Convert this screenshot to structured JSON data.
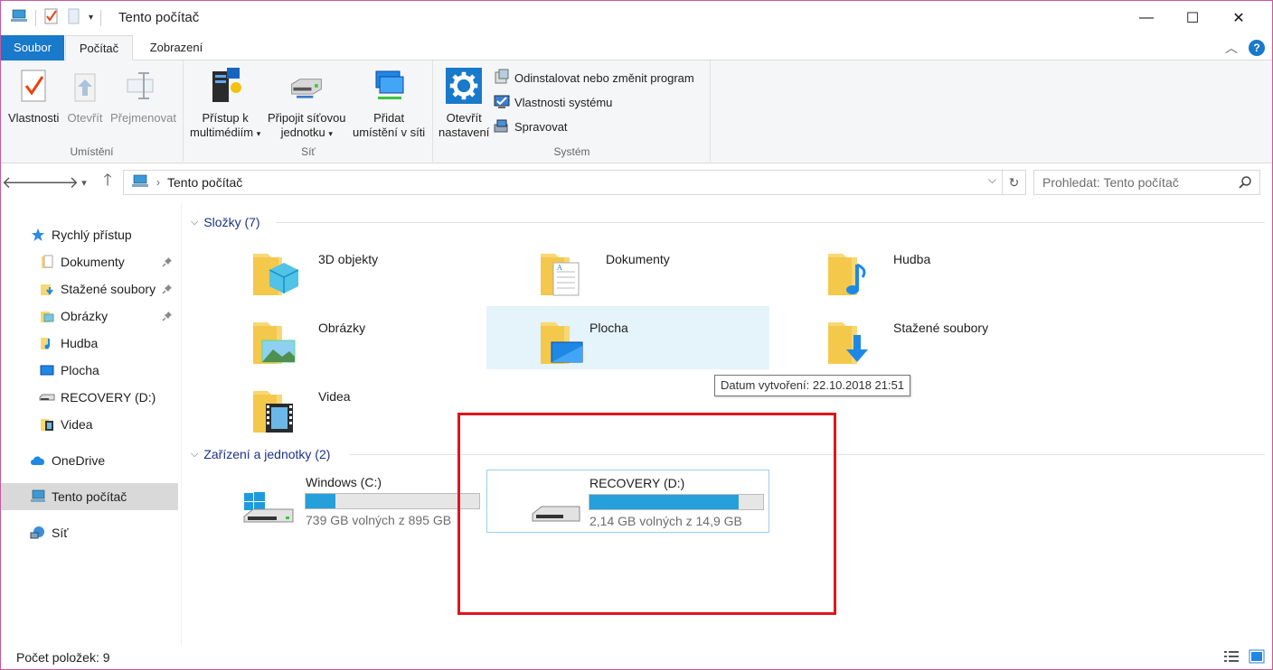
{
  "window": {
    "title": "Tento počítač",
    "minimize_symbol": "—",
    "maximize_symbol": "☐",
    "close_symbol": "✕"
  },
  "ribbon_tabs": [
    {
      "label": "Soubor"
    },
    {
      "label": "Počítač"
    },
    {
      "label": "Zobrazení"
    }
  ],
  "ribbon": {
    "groups": {
      "location": {
        "label": "Umístění",
        "buttons": [
          {
            "label": "Vlastnosti",
            "icon": "properties-check-icon"
          },
          {
            "label": "Otevřít",
            "icon": "open-arrow-icon"
          },
          {
            "label": "Přejmenovat",
            "icon": "rename-icon"
          }
        ]
      },
      "network": {
        "label": "Síť",
        "buttons": [
          {
            "line1": "Přístup k",
            "line2": "multimédiím",
            "icon": "media-server-icon"
          },
          {
            "line1": "Připojit síťovou",
            "line2": "jednotku",
            "icon": "network-drive-icon"
          },
          {
            "line1": "Přidat",
            "line2": "umístění v síti",
            "icon": "network-location-icon"
          }
        ]
      },
      "system": {
        "label": "Systém",
        "open_settings": {
          "line1": "Otevřít",
          "line2": "nastavení",
          "icon": "settings-gear-icon"
        },
        "small": [
          {
            "label": "Odinstalovat nebo změnit program",
            "icon": "uninstall-icon"
          },
          {
            "label": "Vlastnosti systému",
            "icon": "system-properties-icon"
          },
          {
            "label": "Spravovat",
            "icon": "manage-icon"
          }
        ]
      }
    }
  },
  "address": {
    "path": "Tento počítač",
    "search_placeholder": "Prohledat: Tento počítač"
  },
  "sidebar": {
    "items": [
      {
        "label": "Rychlý přístup",
        "icon": "star-icon"
      },
      {
        "label": "Dokumenty",
        "icon": "documents-icon",
        "pinned": true
      },
      {
        "label": "Stažené soubory",
        "icon": "downloads-icon",
        "pinned": true
      },
      {
        "label": "Obrázky",
        "icon": "pictures-icon",
        "pinned": true
      },
      {
        "label": "Hudba",
        "icon": "music-icon"
      },
      {
        "label": "Plocha",
        "icon": "desktop-icon"
      },
      {
        "label": "RECOVERY (D:)",
        "icon": "drive-icon"
      },
      {
        "label": "Videa",
        "icon": "videos-icon"
      },
      {
        "label": "OneDrive",
        "icon": "onedrive-cloud-icon"
      },
      {
        "label": "Tento počítač",
        "icon": "this-pc-icon",
        "selected": true
      },
      {
        "label": "Síť",
        "icon": "network-icon"
      }
    ]
  },
  "content": {
    "folders_header": "Složky (7)",
    "folders": [
      {
        "label": "3D objekty",
        "icon": "3d-objects-folder-icon"
      },
      {
        "label": "Dokumenty",
        "icon": "documents-folder-icon"
      },
      {
        "label": "Hudba",
        "icon": "music-folder-icon"
      },
      {
        "label": "Obrázky",
        "icon": "pictures-folder-icon"
      },
      {
        "label": "Plocha",
        "icon": "desktop-folder-icon"
      },
      {
        "label": "Stažené soubory",
        "icon": "downloads-folder-icon"
      },
      {
        "label": "Videa",
        "icon": "videos-folder-icon"
      }
    ],
    "drives_header": "Zařízení a jednotky (2)",
    "drives": [
      {
        "label": "Windows (C:)",
        "free_text": "739 GB volných z 895 GB",
        "used_fraction": 0.17,
        "icon": "windows-drive-icon"
      },
      {
        "label": "RECOVERY (D:)",
        "free_text": "2,14 GB volných z 14,9 GB",
        "used_fraction": 0.86,
        "icon": "recovery-drive-icon"
      }
    ],
    "tooltip": "Datum vytvoření: 22.10.2018 21:51"
  },
  "status": {
    "item_count": "Počet položek: 9"
  },
  "colors": {
    "accent": "#1979ca",
    "highlight_border": "#e0151c",
    "bar_fill": "#26a0da"
  }
}
